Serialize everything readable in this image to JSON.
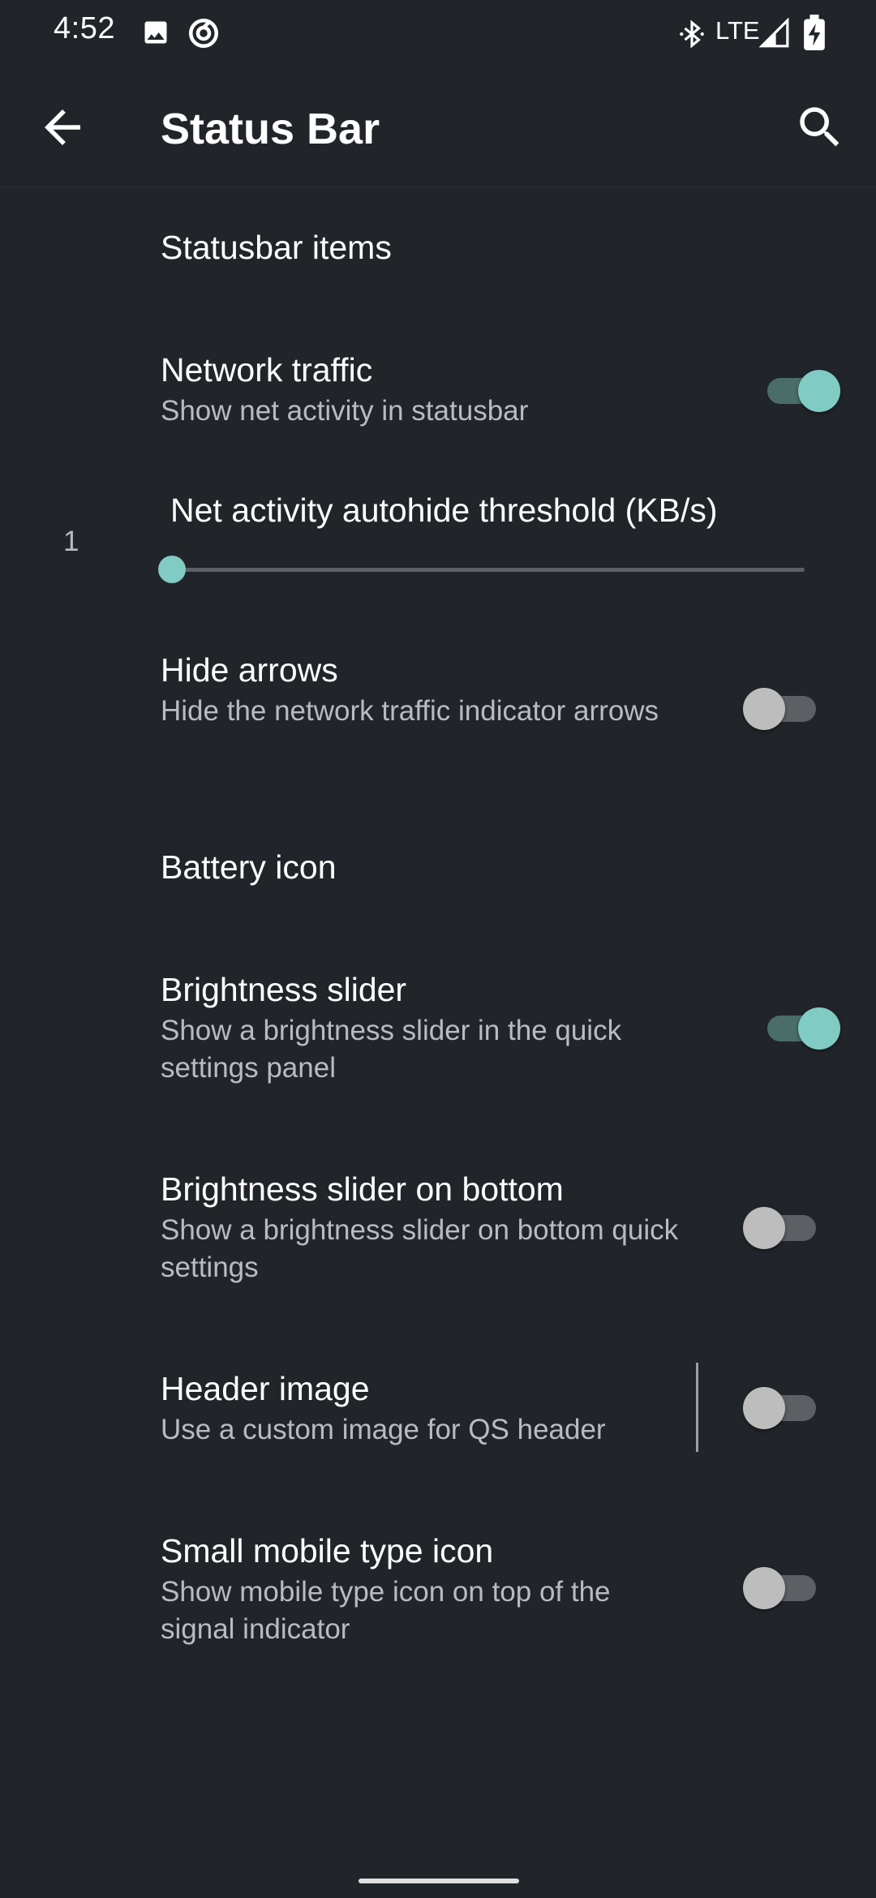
{
  "status_bar": {
    "time": "4:52",
    "network_label": "LTE",
    "icons": [
      "image-icon",
      "sync-icon",
      "bluetooth-icon",
      "signal-icon",
      "battery-charging-icon"
    ]
  },
  "app_bar": {
    "title": "Status Bar",
    "back_icon": "arrow-back-icon",
    "search_icon": "search-icon"
  },
  "colors": {
    "background": "#21252a",
    "accent": "#80cbc4",
    "secondary_text": "#b8bcc1"
  },
  "settings": {
    "statusbar_items": {
      "title": "Statusbar items"
    },
    "network_traffic": {
      "title": "Network traffic",
      "summary": "Show net activity in statusbar",
      "enabled": true
    },
    "autohide_threshold": {
      "title": "Net activity autohide threshold (KB/s)",
      "value": "1",
      "fraction": 0.0
    },
    "hide_arrows": {
      "title": "Hide arrows",
      "summary": "Hide the network traffic indicator arrows",
      "enabled": false
    },
    "battery_icon": {
      "title": "Battery icon"
    },
    "brightness_slider": {
      "title": "Brightness slider",
      "summary": "Show a brightness slider in the quick settings panel",
      "enabled": true
    },
    "brightness_slider_bottom": {
      "title": "Brightness slider on bottom",
      "summary": "Show a brightness slider on bottom quick settings",
      "enabled": false
    },
    "header_image": {
      "title": "Header image",
      "summary": "Use a custom image for QS header",
      "enabled": false
    },
    "small_mobile_type_icon": {
      "title": "Small mobile type icon",
      "summary": "Show mobile type icon on top of the signal indicator",
      "enabled": false
    }
  }
}
